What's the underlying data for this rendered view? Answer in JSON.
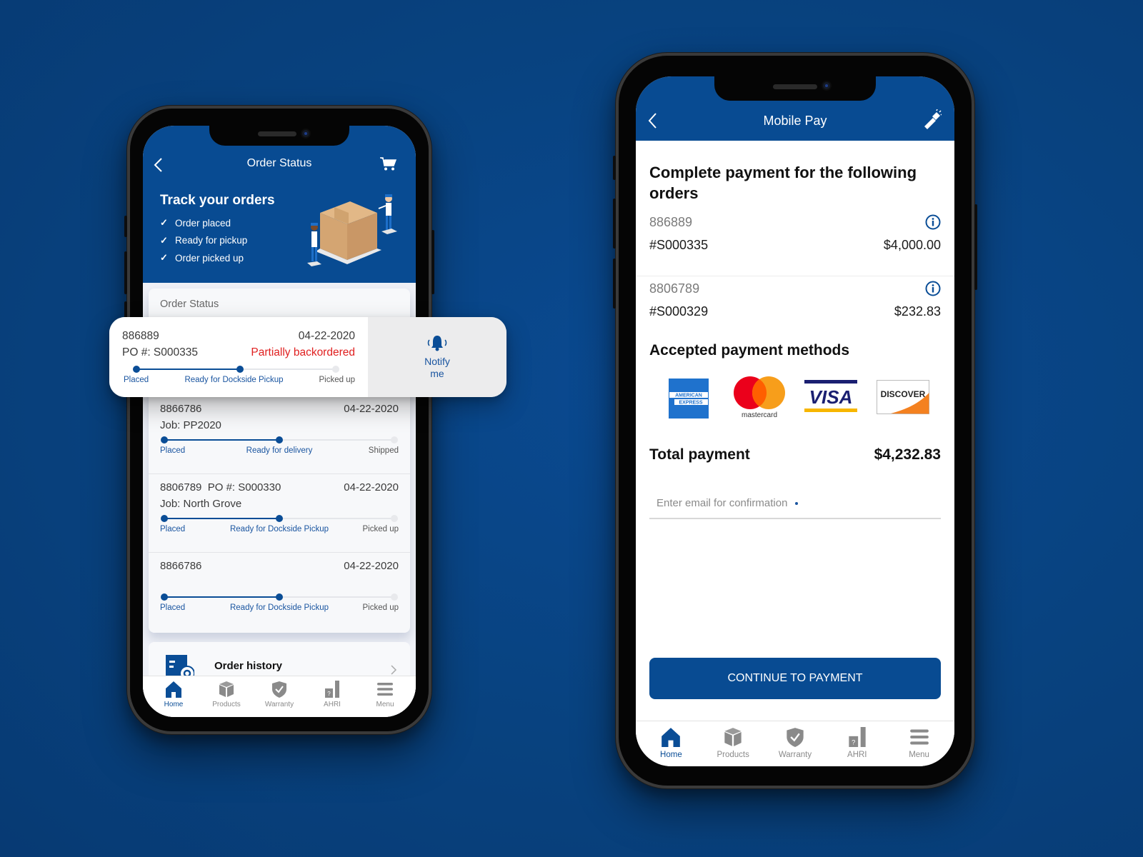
{
  "colors": {
    "brand_blue": "#084b92",
    "background": "#08427f",
    "status_red": "#e02020",
    "progress_done": "#0a4d96",
    "progress_pending": "#e8e9ec"
  },
  "order_status_screen": {
    "header": {
      "title": "Order Status",
      "back_icon": "chevron-left-icon",
      "cart_icon": "shopping-cart-icon"
    },
    "hero": {
      "title": "Track your orders",
      "checklist": [
        "Order placed",
        "Ready for pickup",
        "Order picked up"
      ],
      "illustration": "warehouse-box-illustration"
    },
    "panel_title": "Order Status",
    "highlighted_order": {
      "order_number": "886889",
      "reference": "PO #: S000335",
      "date": "04-22-2020",
      "status": "Partially backordered",
      "progress_steps": [
        "Placed",
        "Ready for Dockside Pickup",
        "Picked up"
      ],
      "completed_steps": 2,
      "action": {
        "label": "Notify me",
        "icon": "bell-ringing-icon"
      }
    },
    "orders": [
      {
        "order_number": "8866786",
        "reference": "Job: PP2020",
        "date": "04-22-2020",
        "progress_steps": [
          "Placed",
          "Ready for delivery",
          "Shipped"
        ],
        "completed_steps": 2
      },
      {
        "order_number": "8806789  PO #: S000330",
        "reference": "Job: North Grove",
        "date": "04-22-2020",
        "progress_steps": [
          "Placed",
          "Ready for Dockside Pickup",
          "Picked up"
        ],
        "completed_steps": 2
      },
      {
        "order_number": "8866786",
        "reference": "",
        "date": "04-22-2020",
        "progress_steps": [
          "Placed",
          "Ready for Dockside Pickup",
          "Picked up"
        ],
        "completed_steps": 2
      }
    ],
    "order_history": {
      "label": "Order history",
      "icon": "order-history-icon"
    }
  },
  "mobile_pay_screen": {
    "header": {
      "title": "Mobile Pay",
      "back_icon": "chevron-left-icon",
      "flashlight_icon": "flashlight-icon"
    },
    "heading": "Complete payment for the following orders",
    "payments": [
      {
        "order_number": "886889",
        "reference": "#S000335",
        "amount": "$4,000.00"
      },
      {
        "order_number": "8806789",
        "reference": "#S000329",
        "amount": "$232.83"
      }
    ],
    "methods_title": "Accepted payment methods",
    "methods": [
      "American Express",
      "Mastercard",
      "Visa",
      "Discover"
    ],
    "total_label": "Total payment",
    "total_value": "$4,232.83",
    "email_placeholder": "Enter email for confirmation",
    "continue_label": "CONTINUE TO PAYMENT"
  },
  "tab_bar": {
    "active": "Home",
    "items": [
      {
        "label": "Home",
        "icon": "home-icon"
      },
      {
        "label": "Products",
        "icon": "box-icon"
      },
      {
        "label": "Warranty",
        "icon": "shield-check-icon"
      },
      {
        "label": "AHRI",
        "icon": "ahri-icon"
      },
      {
        "label": "Menu",
        "icon": "hamburger-menu-icon"
      }
    ]
  },
  "mastercard_wordmark": "mastercard",
  "amex_wordmark": [
    "AMERICAN",
    "EXPRESS"
  ],
  "visa_wordmark": "VISA",
  "discover_wordmark": "DISCOVER"
}
